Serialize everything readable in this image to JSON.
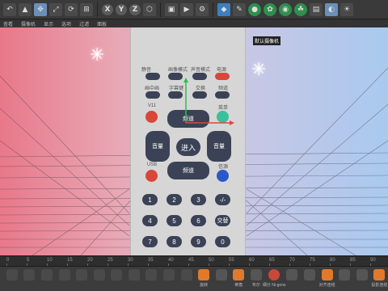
{
  "toolbar": {
    "axes": [
      "X",
      "Y",
      "Z"
    ],
    "icons": [
      "undo-icon",
      "select-icon",
      "move-icon",
      "scale-icon",
      "rotate-icon",
      "coordinate-icon",
      "x-axis-icon",
      "y-axis-icon",
      "z-axis-icon",
      "world-icon",
      "render-region-icon",
      "render-view-icon",
      "render-settings-icon",
      "cube-icon",
      "pen-icon",
      "subdivision-icon",
      "cloner-icon",
      "deformer-icon",
      "field-icon",
      "scene-icon",
      "camera-icon",
      "light-icon"
    ]
  },
  "menubar": [
    "查看",
    "摄像机",
    "显示",
    "选项",
    "过滤",
    "面板"
  ],
  "viewport": {
    "camera_label": "默认摄像机",
    "gradient": [
      "#e8788a",
      "#a9c9ef"
    ]
  },
  "remote": {
    "top_labels": [
      "静音",
      "画像模式",
      "声音模式",
      "电源"
    ],
    "row2_labels": [
      "画中画",
      "字幕键",
      "交换",
      "频道"
    ],
    "row3_labels": [
      "V11",
      "菜单"
    ],
    "dpad": {
      "center": "进入",
      "up": "频道",
      "down": "频道",
      "left": "音量",
      "right": "音量"
    },
    "usb_label": "USB",
    "source_label": "信源",
    "numbers_row1": [
      "1",
      "2",
      "3",
      "-/-"
    ],
    "numbers_row2": [
      "4",
      "5",
      "6",
      "交替"
    ],
    "numbers_row3": [
      "7",
      "8",
      "9",
      "0"
    ],
    "colors": {
      "body": "#d6d6d6",
      "button": "#3b4256",
      "red": "#d9463a",
      "teal": "#3bbf9c",
      "blue": "#2b58c9"
    }
  },
  "timeline": {
    "ticks": [
      "0",
      "5",
      "10",
      "15",
      "20",
      "25",
      "30",
      "35",
      "40",
      "45",
      "50",
      "55",
      "60",
      "65",
      "70",
      "75",
      "80",
      "85",
      "90"
    ]
  },
  "dock": {
    "items": [
      {
        "label": "",
        "icon": "object-icon"
      },
      {
        "label": "",
        "icon": "cylinder-icon"
      },
      {
        "label": "",
        "icon": "spline-icon"
      },
      {
        "label": "",
        "icon": "nurbs-icon"
      },
      {
        "label": "",
        "icon": "array-icon"
      },
      {
        "label": "",
        "icon": "symmetry-icon"
      },
      {
        "label": "",
        "icon": "boole-icon"
      },
      {
        "label": "",
        "icon": "connect-icon"
      },
      {
        "label": "",
        "icon": "instance-icon"
      },
      {
        "label": "",
        "icon": "metaball-icon"
      },
      {
        "label": "",
        "icon": "atom-icon"
      },
      {
        "label": "旋转",
        "icon": "rotate-tool-icon"
      },
      {
        "label": "",
        "icon": "bevel-icon"
      },
      {
        "label": "倒角",
        "icon": "chamfer-icon"
      },
      {
        "label": "布尔",
        "icon": "bool-icon"
      },
      {
        "label": "细分 Ni-gons",
        "icon": "subdiv-icon"
      },
      {
        "label": "",
        "icon": "pin-icon"
      },
      {
        "label": "",
        "icon": "knife-icon"
      },
      {
        "label": "对齐连结",
        "icon": "align-icon"
      },
      {
        "label": "",
        "icon": "weld-icon"
      },
      {
        "label": "",
        "icon": "bridge-icon"
      },
      {
        "label": "投影连结",
        "icon": "project-icon"
      }
    ]
  }
}
